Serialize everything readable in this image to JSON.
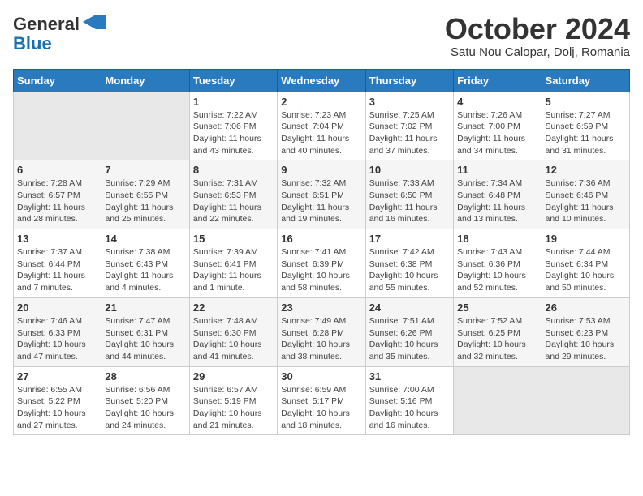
{
  "header": {
    "logo_general": "General",
    "logo_blue": "Blue",
    "month_title": "October 2024",
    "location": "Satu Nou Calopar, Dolj, Romania"
  },
  "days_of_week": [
    "Sunday",
    "Monday",
    "Tuesday",
    "Wednesday",
    "Thursday",
    "Friday",
    "Saturday"
  ],
  "weeks": [
    [
      {
        "day": "",
        "info": ""
      },
      {
        "day": "",
        "info": ""
      },
      {
        "day": "1",
        "info": "Sunrise: 7:22 AM\nSunset: 7:06 PM\nDaylight: 11 hours and 43 minutes."
      },
      {
        "day": "2",
        "info": "Sunrise: 7:23 AM\nSunset: 7:04 PM\nDaylight: 11 hours and 40 minutes."
      },
      {
        "day": "3",
        "info": "Sunrise: 7:25 AM\nSunset: 7:02 PM\nDaylight: 11 hours and 37 minutes."
      },
      {
        "day": "4",
        "info": "Sunrise: 7:26 AM\nSunset: 7:00 PM\nDaylight: 11 hours and 34 minutes."
      },
      {
        "day": "5",
        "info": "Sunrise: 7:27 AM\nSunset: 6:59 PM\nDaylight: 11 hours and 31 minutes."
      }
    ],
    [
      {
        "day": "6",
        "info": "Sunrise: 7:28 AM\nSunset: 6:57 PM\nDaylight: 11 hours and 28 minutes."
      },
      {
        "day": "7",
        "info": "Sunrise: 7:29 AM\nSunset: 6:55 PM\nDaylight: 11 hours and 25 minutes."
      },
      {
        "day": "8",
        "info": "Sunrise: 7:31 AM\nSunset: 6:53 PM\nDaylight: 11 hours and 22 minutes."
      },
      {
        "day": "9",
        "info": "Sunrise: 7:32 AM\nSunset: 6:51 PM\nDaylight: 11 hours and 19 minutes."
      },
      {
        "day": "10",
        "info": "Sunrise: 7:33 AM\nSunset: 6:50 PM\nDaylight: 11 hours and 16 minutes."
      },
      {
        "day": "11",
        "info": "Sunrise: 7:34 AM\nSunset: 6:48 PM\nDaylight: 11 hours and 13 minutes."
      },
      {
        "day": "12",
        "info": "Sunrise: 7:36 AM\nSunset: 6:46 PM\nDaylight: 11 hours and 10 minutes."
      }
    ],
    [
      {
        "day": "13",
        "info": "Sunrise: 7:37 AM\nSunset: 6:44 PM\nDaylight: 11 hours and 7 minutes."
      },
      {
        "day": "14",
        "info": "Sunrise: 7:38 AM\nSunset: 6:43 PM\nDaylight: 11 hours and 4 minutes."
      },
      {
        "day": "15",
        "info": "Sunrise: 7:39 AM\nSunset: 6:41 PM\nDaylight: 11 hours and 1 minute."
      },
      {
        "day": "16",
        "info": "Sunrise: 7:41 AM\nSunset: 6:39 PM\nDaylight: 10 hours and 58 minutes."
      },
      {
        "day": "17",
        "info": "Sunrise: 7:42 AM\nSunset: 6:38 PM\nDaylight: 10 hours and 55 minutes."
      },
      {
        "day": "18",
        "info": "Sunrise: 7:43 AM\nSunset: 6:36 PM\nDaylight: 10 hours and 52 minutes."
      },
      {
        "day": "19",
        "info": "Sunrise: 7:44 AM\nSunset: 6:34 PM\nDaylight: 10 hours and 50 minutes."
      }
    ],
    [
      {
        "day": "20",
        "info": "Sunrise: 7:46 AM\nSunset: 6:33 PM\nDaylight: 10 hours and 47 minutes."
      },
      {
        "day": "21",
        "info": "Sunrise: 7:47 AM\nSunset: 6:31 PM\nDaylight: 10 hours and 44 minutes."
      },
      {
        "day": "22",
        "info": "Sunrise: 7:48 AM\nSunset: 6:30 PM\nDaylight: 10 hours and 41 minutes."
      },
      {
        "day": "23",
        "info": "Sunrise: 7:49 AM\nSunset: 6:28 PM\nDaylight: 10 hours and 38 minutes."
      },
      {
        "day": "24",
        "info": "Sunrise: 7:51 AM\nSunset: 6:26 PM\nDaylight: 10 hours and 35 minutes."
      },
      {
        "day": "25",
        "info": "Sunrise: 7:52 AM\nSunset: 6:25 PM\nDaylight: 10 hours and 32 minutes."
      },
      {
        "day": "26",
        "info": "Sunrise: 7:53 AM\nSunset: 6:23 PM\nDaylight: 10 hours and 29 minutes."
      }
    ],
    [
      {
        "day": "27",
        "info": "Sunrise: 6:55 AM\nSunset: 5:22 PM\nDaylight: 10 hours and 27 minutes."
      },
      {
        "day": "28",
        "info": "Sunrise: 6:56 AM\nSunset: 5:20 PM\nDaylight: 10 hours and 24 minutes."
      },
      {
        "day": "29",
        "info": "Sunrise: 6:57 AM\nSunset: 5:19 PM\nDaylight: 10 hours and 21 minutes."
      },
      {
        "day": "30",
        "info": "Sunrise: 6:59 AM\nSunset: 5:17 PM\nDaylight: 10 hours and 18 minutes."
      },
      {
        "day": "31",
        "info": "Sunrise: 7:00 AM\nSunset: 5:16 PM\nDaylight: 10 hours and 16 minutes."
      },
      {
        "day": "",
        "info": ""
      },
      {
        "day": "",
        "info": ""
      }
    ]
  ]
}
